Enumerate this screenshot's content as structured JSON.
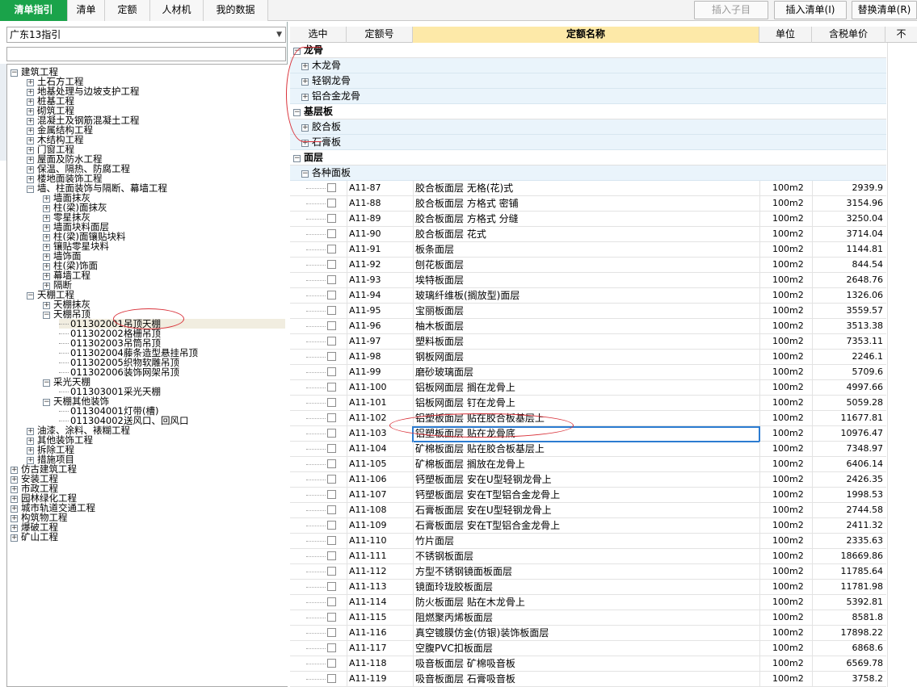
{
  "tabs": [
    "清单指引",
    "清单",
    "定额",
    "人材机",
    "我的数据"
  ],
  "toolbar": {
    "insert_child": "插入子目",
    "insert_list": "插入清单(I)",
    "replace_list": "替换清单(R)"
  },
  "left": {
    "dropdown_value": "广东13指引",
    "tree": [
      {
        "type": "node",
        "level": 0,
        "toggle": "⊟",
        "label": "建筑工程"
      },
      {
        "type": "node",
        "level": 1,
        "toggle": "⊞",
        "label": "土石方工程"
      },
      {
        "type": "node",
        "level": 1,
        "toggle": "⊞",
        "label": "地基处理与边坡支护工程"
      },
      {
        "type": "node",
        "level": 1,
        "toggle": "⊞",
        "label": "桩基工程"
      },
      {
        "type": "node",
        "level": 1,
        "toggle": "⊞",
        "label": "砌筑工程"
      },
      {
        "type": "node",
        "level": 1,
        "toggle": "⊞",
        "label": "混凝土及钢筋混凝土工程"
      },
      {
        "type": "node",
        "level": 1,
        "toggle": "⊞",
        "label": "金属结构工程"
      },
      {
        "type": "node",
        "level": 1,
        "toggle": "⊞",
        "label": "木结构工程"
      },
      {
        "type": "node",
        "level": 1,
        "toggle": "⊞",
        "label": "门窗工程"
      },
      {
        "type": "node",
        "level": 1,
        "toggle": "⊞",
        "label": "屋面及防水工程"
      },
      {
        "type": "node",
        "level": 1,
        "toggle": "⊞",
        "label": "保温、隔热、防腐工程"
      },
      {
        "type": "node",
        "level": 1,
        "toggle": "⊞",
        "label": "楼地面装饰工程"
      },
      {
        "type": "node",
        "level": 1,
        "toggle": "⊟",
        "label": "墙、柱面装饰与隔断、幕墙工程"
      },
      {
        "type": "node",
        "level": 2,
        "toggle": "⊞",
        "label": "墙面抹灰"
      },
      {
        "type": "node",
        "level": 2,
        "toggle": "⊞",
        "label": "柱(梁)面抹灰"
      },
      {
        "type": "node",
        "level": 2,
        "toggle": "⊞",
        "label": "零星抹灰"
      },
      {
        "type": "node",
        "level": 2,
        "toggle": "⊞",
        "label": "墙面块料面层"
      },
      {
        "type": "node",
        "level": 2,
        "toggle": "⊞",
        "label": "柱(梁)面镶贴块料"
      },
      {
        "type": "node",
        "level": 2,
        "toggle": "⊞",
        "label": "镶贴零星块料"
      },
      {
        "type": "node",
        "level": 2,
        "toggle": "⊞",
        "label": "墙饰面"
      },
      {
        "type": "node",
        "level": 2,
        "toggle": "⊞",
        "label": "柱(梁)饰面"
      },
      {
        "type": "node",
        "level": 2,
        "toggle": "⊞",
        "label": "幕墙工程"
      },
      {
        "type": "node",
        "level": 2,
        "toggle": "⊞",
        "label": "隔断"
      },
      {
        "type": "node",
        "level": 1,
        "toggle": "⊟",
        "label": "天棚工程"
      },
      {
        "type": "node",
        "level": 2,
        "toggle": "⊞",
        "label": "天棚抹灰"
      },
      {
        "type": "node",
        "level": 2,
        "toggle": "⊟",
        "label": "天棚吊顶"
      },
      {
        "type": "leaf",
        "level": 3,
        "code": "011302001",
        "label": "吊顶天棚",
        "selected": true
      },
      {
        "type": "leaf",
        "level": 3,
        "code": "011302002",
        "label": "格栅吊顶"
      },
      {
        "type": "leaf",
        "level": 3,
        "code": "011302003",
        "label": "吊筒吊顶"
      },
      {
        "type": "leaf",
        "level": 3,
        "code": "011302004",
        "label": "藤条造型悬挂吊顶"
      },
      {
        "type": "leaf",
        "level": 3,
        "code": "011302005",
        "label": "织物软雕吊顶"
      },
      {
        "type": "leaf",
        "level": 3,
        "code": "011302006",
        "label": "装饰网架吊顶"
      },
      {
        "type": "node",
        "level": 2,
        "toggle": "⊟",
        "label": "采光天棚"
      },
      {
        "type": "leaf",
        "level": 3,
        "code": "011303001",
        "label": "采光天棚"
      },
      {
        "type": "node",
        "level": 2,
        "toggle": "⊟",
        "label": "天棚其他装饰"
      },
      {
        "type": "leaf",
        "level": 3,
        "code": "011304001",
        "label": "灯带(槽)"
      },
      {
        "type": "leaf",
        "level": 3,
        "code": "011304002",
        "label": "送风口、回风口"
      },
      {
        "type": "node",
        "level": 1,
        "toggle": "⊞",
        "label": "油漆、涂料、裱糊工程"
      },
      {
        "type": "node",
        "level": 1,
        "toggle": "⊞",
        "label": "其他装饰工程"
      },
      {
        "type": "node",
        "level": 1,
        "toggle": "⊞",
        "label": "拆除工程"
      },
      {
        "type": "node",
        "level": 1,
        "toggle": "⊞",
        "label": "措施项目"
      },
      {
        "type": "node",
        "level": 0,
        "toggle": "⊞",
        "label": "仿古建筑工程"
      },
      {
        "type": "node",
        "level": 0,
        "toggle": "⊞",
        "label": "安装工程"
      },
      {
        "type": "node",
        "level": 0,
        "toggle": "⊞",
        "label": "市政工程"
      },
      {
        "type": "node",
        "level": 0,
        "toggle": "⊞",
        "label": "园林绿化工程"
      },
      {
        "type": "node",
        "level": 0,
        "toggle": "⊞",
        "label": "城市轨道交通工程"
      },
      {
        "type": "node",
        "level": 0,
        "toggle": "⊞",
        "label": "构筑物工程"
      },
      {
        "type": "node",
        "level": 0,
        "toggle": "⊞",
        "label": "爆破工程"
      },
      {
        "type": "node",
        "level": 0,
        "toggle": "⊞",
        "label": "矿山工程"
      }
    ]
  },
  "grid": {
    "headers": [
      "选中",
      "定额号",
      "定额名称",
      "单位",
      "含税单价",
      "不"
    ],
    "rows": [
      {
        "kind": "group",
        "toggle": "⊟",
        "label": "龙骨"
      },
      {
        "kind": "sub",
        "toggle": "⊞",
        "label": "木龙骨"
      },
      {
        "kind": "sub",
        "toggle": "⊞",
        "label": "轻钢龙骨"
      },
      {
        "kind": "sub",
        "toggle": "⊞",
        "label": "铝合金龙骨"
      },
      {
        "kind": "group",
        "toggle": "⊟",
        "label": "基层板"
      },
      {
        "kind": "sub",
        "toggle": "⊞",
        "label": "胶合板"
      },
      {
        "kind": "sub",
        "toggle": "⊞",
        "label": "石膏板"
      },
      {
        "kind": "group",
        "toggle": "⊟",
        "label": "面层"
      },
      {
        "kind": "sub",
        "toggle": "⊟",
        "label": "各种面板"
      },
      {
        "kind": "data",
        "code": "A11-87",
        "name": "胶合板面层 无格(花)式",
        "unit": "100m2",
        "price": "2939.9"
      },
      {
        "kind": "data",
        "code": "A11-88",
        "name": "胶合板面层 方格式 密铺",
        "unit": "100m2",
        "price": "3154.96"
      },
      {
        "kind": "data",
        "code": "A11-89",
        "name": "胶合板面层 方格式 分缝",
        "unit": "100m2",
        "price": "3250.04"
      },
      {
        "kind": "data",
        "code": "A11-90",
        "name": "胶合板面层 花式",
        "unit": "100m2",
        "price": "3714.04"
      },
      {
        "kind": "data",
        "code": "A11-91",
        "name": "板条面层",
        "unit": "100m2",
        "price": "1144.81"
      },
      {
        "kind": "data",
        "code": "A11-92",
        "name": "刨花板面层",
        "unit": "100m2",
        "price": "844.54"
      },
      {
        "kind": "data",
        "code": "A11-93",
        "name": "埃特板面层",
        "unit": "100m2",
        "price": "2648.76"
      },
      {
        "kind": "data",
        "code": "A11-94",
        "name": "玻璃纤维板(搁放型)面层",
        "unit": "100m2",
        "price": "1326.06"
      },
      {
        "kind": "data",
        "code": "A11-95",
        "name": "宝丽板面层",
        "unit": "100m2",
        "price": "3559.57"
      },
      {
        "kind": "data",
        "code": "A11-96",
        "name": "柚木板面层",
        "unit": "100m2",
        "price": "3513.38"
      },
      {
        "kind": "data",
        "code": "A11-97",
        "name": "塑料板面层",
        "unit": "100m2",
        "price": "7353.11"
      },
      {
        "kind": "data",
        "code": "A11-98",
        "name": "钢板网面层",
        "unit": "100m2",
        "price": "2246.1"
      },
      {
        "kind": "data",
        "code": "A11-99",
        "name": "磨砂玻璃面层",
        "unit": "100m2",
        "price": "5709.6"
      },
      {
        "kind": "data",
        "code": "A11-100",
        "name": "铝板网面层 搁在龙骨上",
        "unit": "100m2",
        "price": "4997.66"
      },
      {
        "kind": "data",
        "code": "A11-101",
        "name": "铝板网面层 钉在龙骨上",
        "unit": "100m2",
        "price": "5059.28"
      },
      {
        "kind": "data",
        "code": "A11-102",
        "name": "铝塑板面层 贴在胶合板基层上",
        "unit": "100m2",
        "price": "11677.81"
      },
      {
        "kind": "data",
        "code": "A11-103",
        "name": "铝塑板面层 贴在龙骨底",
        "unit": "100m2",
        "price": "10976.47",
        "focused": true
      },
      {
        "kind": "data",
        "code": "A11-104",
        "name": "矿棉板面层 贴在胶合板基层上",
        "unit": "100m2",
        "price": "7348.97"
      },
      {
        "kind": "data",
        "code": "A11-105",
        "name": "矿棉板面层 搁放在龙骨上",
        "unit": "100m2",
        "price": "6406.14"
      },
      {
        "kind": "data",
        "code": "A11-106",
        "name": "钙塑板面层 安在U型轻钢龙骨上",
        "unit": "100m2",
        "price": "2426.35"
      },
      {
        "kind": "data",
        "code": "A11-107",
        "name": "钙塑板面层 安在T型铝合金龙骨上",
        "unit": "100m2",
        "price": "1998.53"
      },
      {
        "kind": "data",
        "code": "A11-108",
        "name": "石膏板面层 安在U型轻钢龙骨上",
        "unit": "100m2",
        "price": "2744.58"
      },
      {
        "kind": "data",
        "code": "A11-109",
        "name": "石膏板面层 安在T型铝合金龙骨上",
        "unit": "100m2",
        "price": "2411.32"
      },
      {
        "kind": "data",
        "code": "A11-110",
        "name": "竹片面层",
        "unit": "100m2",
        "price": "2335.63"
      },
      {
        "kind": "data",
        "code": "A11-111",
        "name": "不锈钢板面层",
        "unit": "100m2",
        "price": "18669.86"
      },
      {
        "kind": "data",
        "code": "A11-112",
        "name": "方型不锈钢镜面板面层",
        "unit": "100m2",
        "price": "11785.64"
      },
      {
        "kind": "data",
        "code": "A11-113",
        "name": "镜面玲珑胶板面层",
        "unit": "100m2",
        "price": "11781.98"
      },
      {
        "kind": "data",
        "code": "A11-114",
        "name": "防火板面层 贴在木龙骨上",
        "unit": "100m2",
        "price": "5392.81"
      },
      {
        "kind": "data",
        "code": "A11-115",
        "name": "阻燃聚丙烯板面层",
        "unit": "100m2",
        "price": "8581.8"
      },
      {
        "kind": "data",
        "code": "A11-116",
        "name": "真空镀膜仿金(仿银)装饰板面层",
        "unit": "100m2",
        "price": "17898.22"
      },
      {
        "kind": "data",
        "code": "A11-117",
        "name": "空腹PVC扣板面层",
        "unit": "100m2",
        "price": "6868.6"
      },
      {
        "kind": "data",
        "code": "A11-118",
        "name": "吸音板面层 矿棉吸音板",
        "unit": "100m2",
        "price": "6569.78"
      },
      {
        "kind": "data",
        "code": "A11-119",
        "name": "吸音板面层 石膏吸音板",
        "unit": "100m2",
        "price": "3758.2"
      }
    ]
  }
}
